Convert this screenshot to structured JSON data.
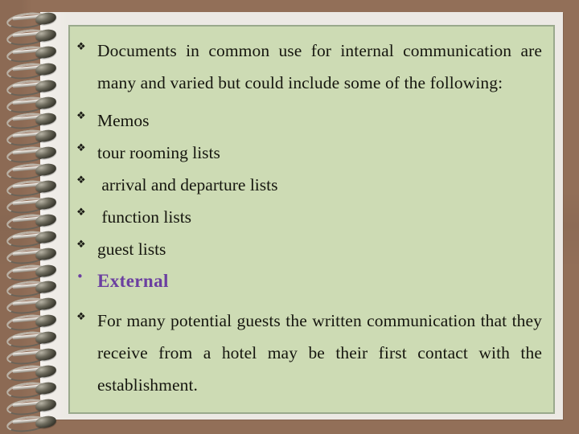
{
  "slide": {
    "background_color": "#926f58",
    "page_color": "#ece9e4",
    "panel_color": "#cddbb4",
    "panel_border_color": "#9aa98c",
    "body_text_color": "#16160f",
    "accent_color": "#6b3fa0"
  },
  "bullets": {
    "diamond_glyph": "❖",
    "round_glyph": "•"
  },
  "content": {
    "paragraph_intro": "Documents in common use for internal communication are many and varied but could include some of the following:",
    "items": [
      "Memos",
      "tour rooming lists",
      " arrival and departure lists",
      " function lists",
      "guest lists"
    ],
    "heading": "External",
    "paragraph_closing": "For many potential guests the written communication that they receive from a hotel may be their first contact with the establishment."
  }
}
